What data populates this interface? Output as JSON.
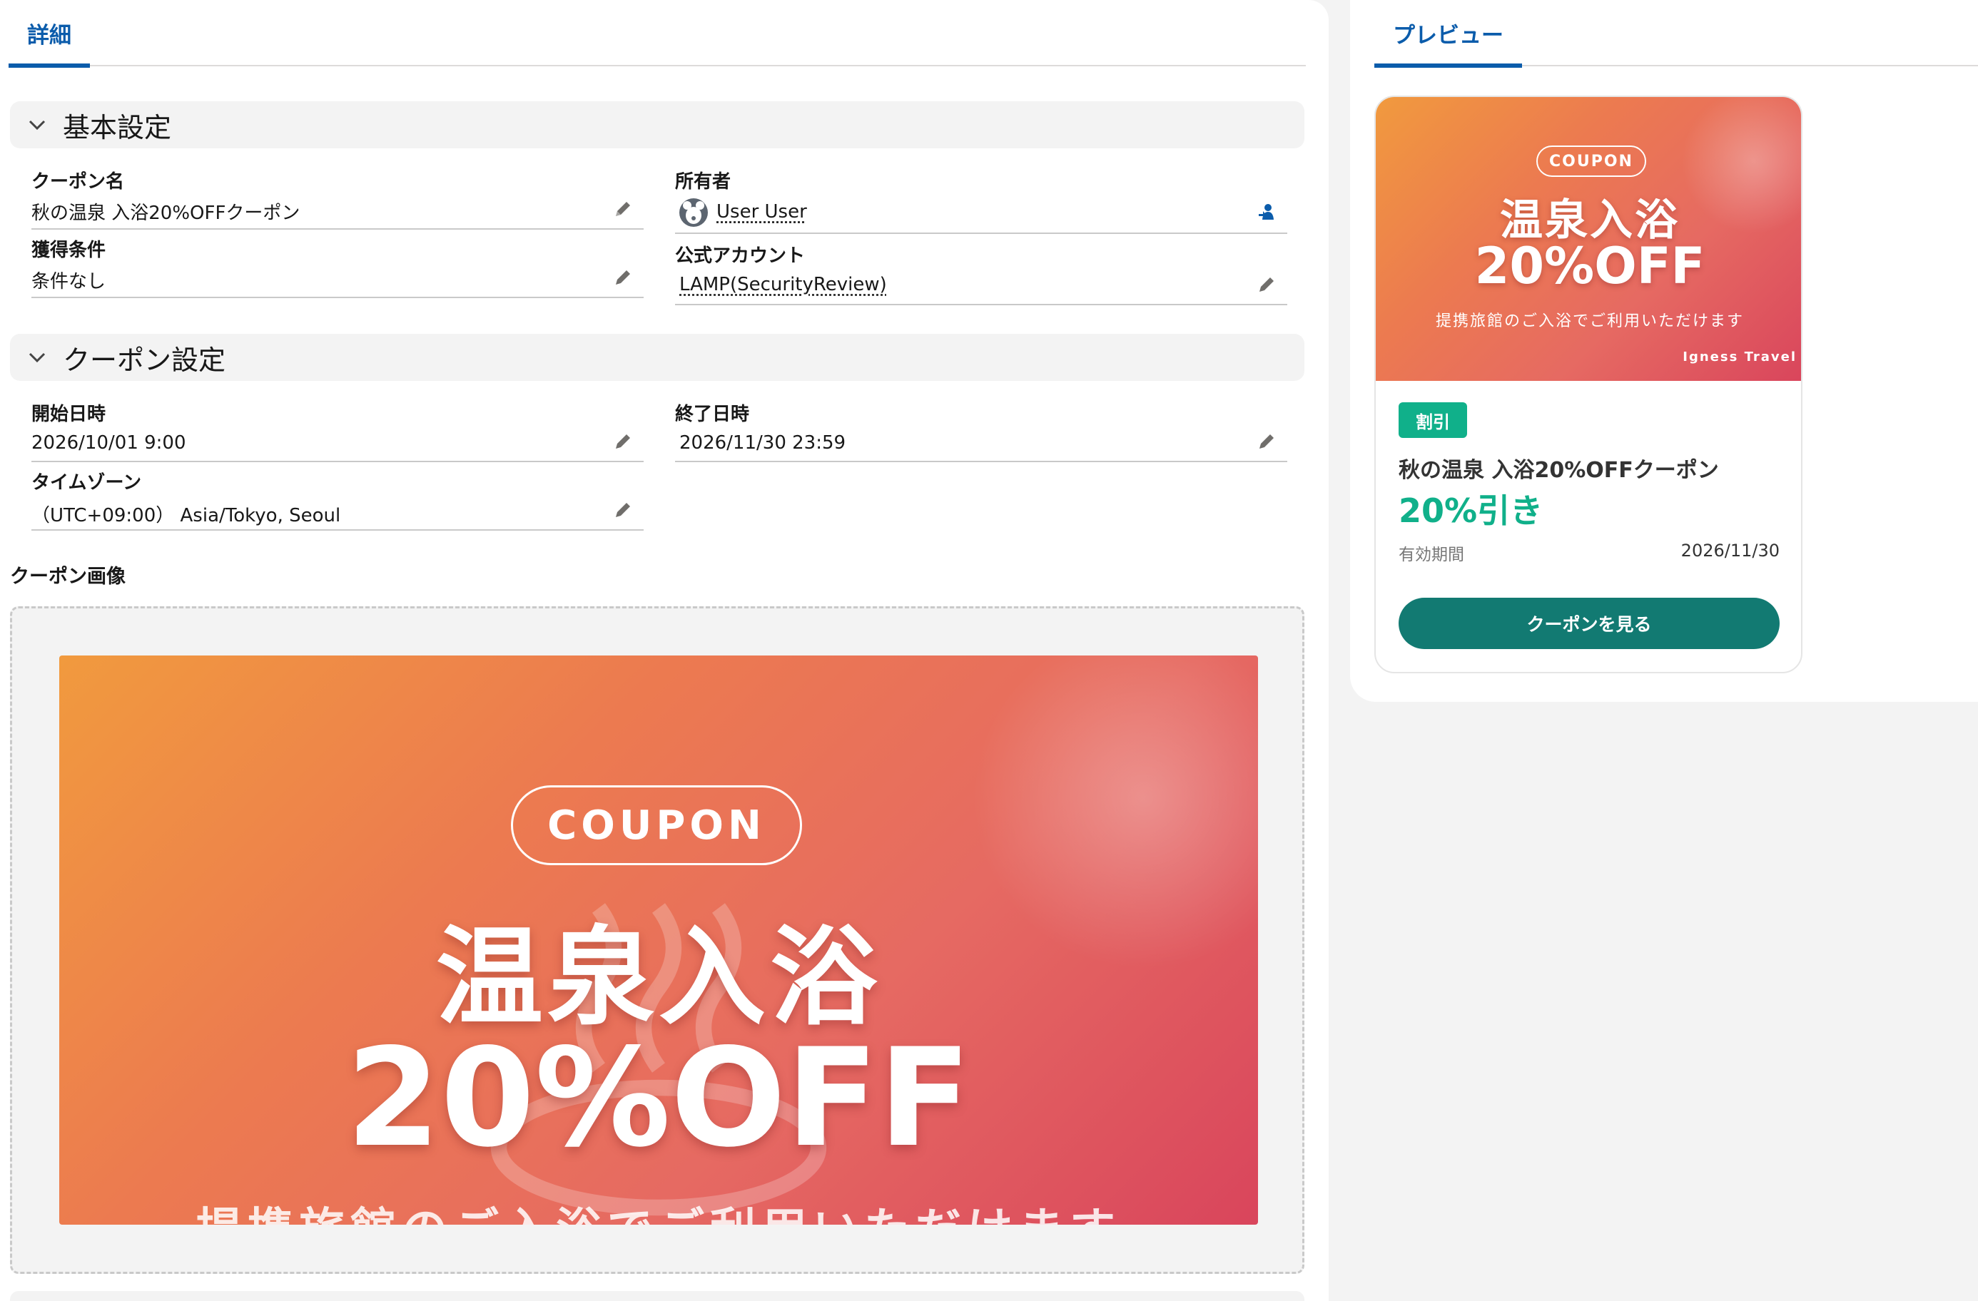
{
  "tabs": {
    "detail": "詳細",
    "preview": "プレビュー"
  },
  "sections": {
    "basic": "基本設定",
    "coupon": "クーポン設定"
  },
  "fields": {
    "coupon_name": {
      "label": "クーポン名",
      "value": "秋の温泉 入浴20%OFFクーポン"
    },
    "owner": {
      "label": "所有者",
      "value": "User User"
    },
    "condition": {
      "label": "獲得条件",
      "value": "条件なし"
    },
    "official_account": {
      "label": "公式アカウント",
      "value": "LAMP(SecurityReview)"
    },
    "start": {
      "label": "開始日時",
      "value": "2026/10/01 9:00"
    },
    "end": {
      "label": "終了日時",
      "value": "2026/11/30 23:59"
    },
    "timezone": {
      "label": "タイムゾーン",
      "value": "（UTC+09:00） Asia/Tokyo, Seoul"
    }
  },
  "coupon_image": {
    "label": "クーポン画像",
    "badge": "COUPON",
    "headline": "温泉入浴",
    "discount": "20%OFF",
    "subtitle": "提携旅館のご入浴でご利用いただけます",
    "brand": "Igness Travel"
  },
  "preview": {
    "category": "割引",
    "title": "秋の温泉 入浴20%OFFクーポン",
    "discount_text": "20%引き",
    "valid_label": "有効期間",
    "valid_date": "2026/11/30",
    "button": "クーポンを見る"
  },
  "colors": {
    "accent": "#0b5cab",
    "green": "#10b08a",
    "teal_button": "#127a72"
  },
  "icons": [
    "chevron-down-icon",
    "pencil-icon",
    "user-avatar-icon",
    "change-owner-icon"
  ]
}
